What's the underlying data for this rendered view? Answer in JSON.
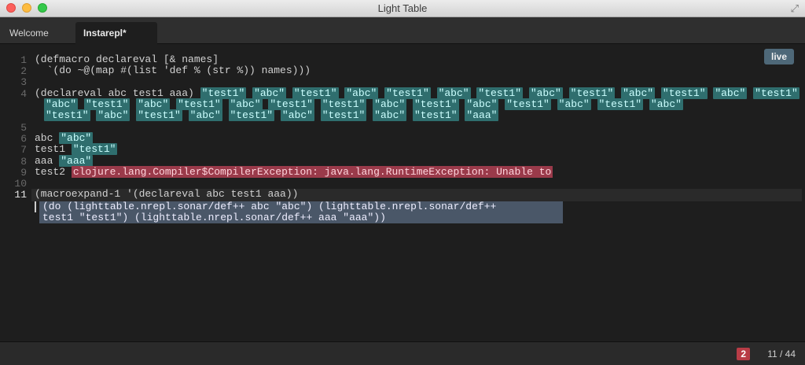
{
  "window": {
    "title": "Light Table"
  },
  "tabs": [
    {
      "label": "Welcome"
    },
    {
      "label": "Instarepl*"
    }
  ],
  "editor": {
    "live_label": "live",
    "line_numbers": [
      "1",
      "2",
      "3",
      "4",
      "5",
      "6",
      "7",
      "8",
      "9",
      "10",
      "11"
    ],
    "lines": {
      "l1": "(defmacro declareval [& names]",
      "l2": "  `(do ~@(map #(list 'def % (str %)) names)))",
      "l4a": "(declareval abc test1 aaa)",
      "l4_results": [
        "\"test1\"",
        "\"abc\"",
        "\"test1\"",
        "\"abc\"",
        "\"test1\"",
        "\"abc\"",
        "\"test1\"",
        "\"abc\"",
        "\"test1\"",
        "\"abc\"",
        "\"test1\"",
        "\"abc\"",
        "\"test1\""
      ],
      "l4_cont1": [
        "\"abc\"",
        "\"test1\"",
        "\"abc\"",
        "\"test1\"",
        "\"abc\"",
        "\"test1\"",
        "\"test1\"",
        "\"abc\"",
        "\"test1\"",
        "\"abc\"",
        "\"test1\"",
        "\"abc\"",
        "\"test1\"",
        "\"abc\""
      ],
      "l4_cont2": [
        "\"test1\"",
        "\"abc\"",
        "\"test1\"",
        "\"abc\"",
        "\"test1\"",
        "\"abc\"",
        "\"test1\"",
        "\"abc\"",
        "\"test1\"",
        "\"aaa\""
      ],
      "l6": "abc",
      "l6r": "\"abc\"",
      "l7": "test1",
      "l7r": "\"test1\"",
      "l8": "aaa",
      "l8r": "\"aaa\"",
      "l9": "test2",
      "l9err": "clojure.lang.Compiler$CompilerException: java.lang.RuntimeException: Unable to",
      "l11": "(macroexpand-1 '(declareval abc test1 aaa))",
      "expansion1": "(do (lighttable.nrepl.sonar/def++ abc \"abc\") (lighttable.nrepl.sonar/def++",
      "expansion2": "test1 \"test1\") (lighttable.nrepl.sonar/def++ aaa \"aaa\"))"
    }
  },
  "status": {
    "error_count": "2",
    "position": "11 / 44"
  },
  "colors": {
    "result_bg": "#2f6e6e",
    "error_bg": "#9a3a4a",
    "live_bg": "#4e6878",
    "accent_error": "#b83c46"
  }
}
